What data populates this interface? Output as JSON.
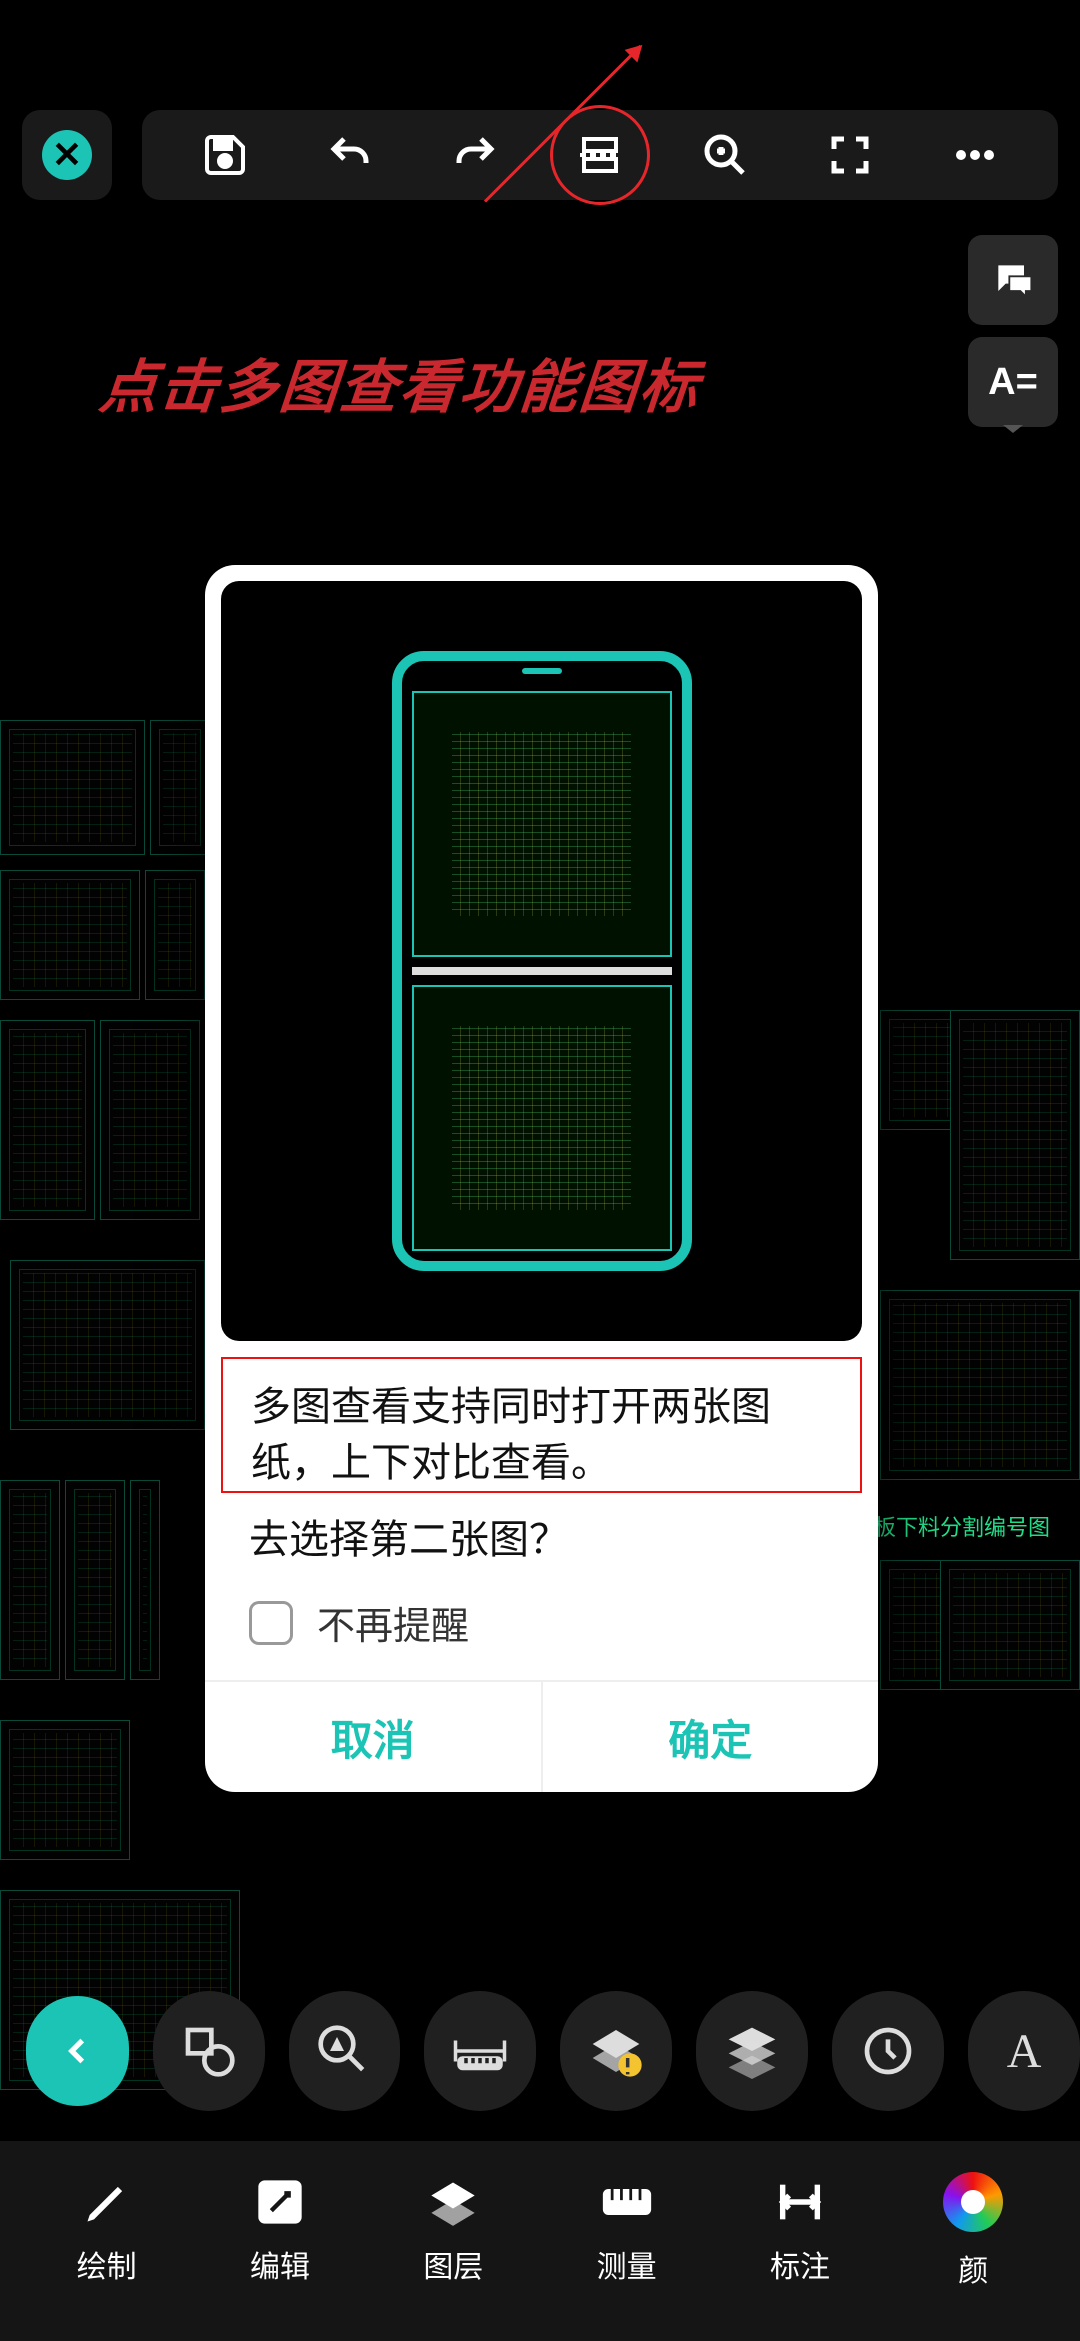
{
  "hint_text": "点击多图查看功能图标",
  "cad_label_text": "平板下料分割编号图",
  "toolbar": {
    "close": "close",
    "save": "save",
    "undo": "undo",
    "redo": "redo",
    "split_view": "split-view",
    "zoom": "zoom",
    "fullscreen": "fullscreen",
    "more": "more"
  },
  "side": {
    "chat": "chat",
    "text_style": "A="
  },
  "modal": {
    "description": "多图查看支持同时打开两张图纸，上下对比查看。",
    "question": "去选择第二张图？",
    "dont_remind_label": "不再提醒",
    "cancel_label": "取消",
    "confirm_label": "确定"
  },
  "float_actions": {
    "back": "back",
    "shapes": "shapes",
    "search_shape": "search-shape",
    "ruler": "ruler",
    "layer_tip": "layers-tip",
    "layers": "layers",
    "clock": "clock",
    "text": "A"
  },
  "bottom_nav": {
    "draw": "绘制",
    "edit": "编辑",
    "layers": "图层",
    "measure": "测量",
    "annotate": "标注",
    "color": "颜"
  }
}
